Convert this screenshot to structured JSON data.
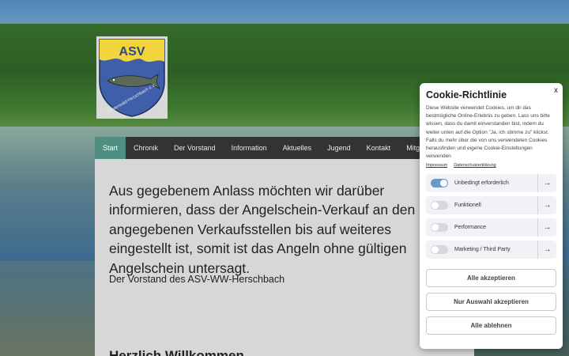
{
  "logo": {
    "text": "ASV",
    "ring_text": "Westerwald-Herschbach e.V."
  },
  "nav": {
    "items": [
      "Start",
      "Chronik",
      "Der Vorstand",
      "Information",
      "Aktuelles",
      "Jugend",
      "Kontakt",
      "Mitg"
    ],
    "active": "Start"
  },
  "content": {
    "notice": "Aus gegebenem Anlass möchten wir darüber informieren, dass der Angelschein-Verkauf an den angegebenen Verkaufsstellen bis auf weiteres eingestellt ist, somit ist das Angeln ohne gültigen Angelschein untersagt.",
    "signoff": "Der Vorstand des ASV-WW-Herschbach",
    "welcome": "Herzlich Willkommen"
  },
  "cookie": {
    "close": "x",
    "title": "Cookie-Richtlinie",
    "description": "Diese Website verwendet Cookies, um dir das bestmögliche Online-Erlebnis zu geben. Lass uns bitte wissen, dass du damit einverstanden bist, indem du weiter unten auf die Option \"Ja, ich stimme zu\" klickst. Falls du mehr über die von uns verwendeten Cookies herausfinden und eigene Cookie-Einstellungen verwenden",
    "links": {
      "impressum": "Impressum",
      "privacy": "Datenschutzerklärung"
    },
    "categories": [
      {
        "label": "Unbedingt erforderlich",
        "enabled": true
      },
      {
        "label": "Funktionell",
        "enabled": false
      },
      {
        "label": "Performance",
        "enabled": false
      },
      {
        "label": "Marketing / Third Party",
        "enabled": false
      }
    ],
    "arrow": "→",
    "buttons": {
      "accept_all": "Alle akzeptieren",
      "accept_selection": "Nur Auswahl akzeptieren",
      "reject_all": "Alle ablehnen"
    }
  },
  "colors": {
    "nav_bg": "#333333",
    "nav_active": "#4f8f82",
    "toggle_on": "#6a9bc7",
    "logo_yellow": "#f2d43c",
    "logo_blue": "#3f5fa8"
  }
}
